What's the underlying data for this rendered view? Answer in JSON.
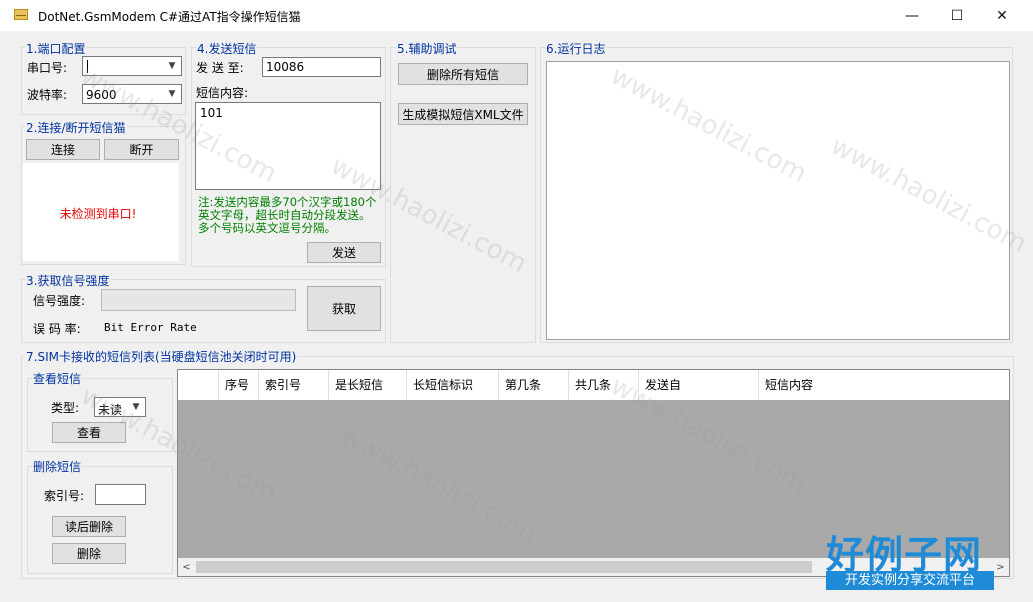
{
  "window": {
    "title": "DotNet.GsmModem C#通过AT指令操作短信猫",
    "controls": {
      "minimize": "—",
      "maximize": "☐",
      "close": "✕"
    }
  },
  "port_config": {
    "title": "1.端口配置",
    "port_label": "串口号:",
    "port_value": "",
    "baud_label": "波特率:",
    "baud_value": "9600"
  },
  "connection": {
    "title": "2.连接/断开短信猫",
    "connect_label": "连接",
    "disconnect_label": "断开",
    "status_text": "未检测到串口!",
    "status_color": "#e00000"
  },
  "send_sms": {
    "title": "4.发送短信",
    "to_label": "发 送 至:",
    "to_value": "10086",
    "content_label": "短信内容:",
    "content_value": "101",
    "note": "注:发送内容最多70个汉字或180个英文字母，超长时自动分段发送。多个号码以英文逗号分隔。",
    "note_color": "#008000",
    "send_label": "发送"
  },
  "debug": {
    "title": "5.辅助调试",
    "delete_all_label": "删除所有短信",
    "gen_xml_label": "生成模拟短信XML文件"
  },
  "log": {
    "title": "6.运行日志"
  },
  "signal": {
    "title": "3.获取信号强度",
    "strength_label": "信号强度:",
    "error_rate_label": "误 码 率:",
    "error_rate_value": "Bit Error Rate",
    "get_label": "获取"
  },
  "sim_list": {
    "title": "7.SIM卡接收的短信列表(当硬盘短信池关闭时可用)",
    "view": {
      "title": "查看短信",
      "type_label": "类型:",
      "type_value": "未读",
      "view_label": "查看"
    },
    "delete": {
      "title": "删除短信",
      "index_label": "索引号:",
      "index_value": "",
      "read_delete_label": "读后删除",
      "delete_label": "删除"
    },
    "columns": [
      "序号",
      "索引号",
      "是长短信",
      "长短信标识",
      "第几条",
      "共几条",
      "发送自",
      "短信内容"
    ]
  },
  "watermark": {
    "text": "www.haolizi.com",
    "logo_main": "好例子网",
    "logo_sub": "开发实例分享交流平台"
  }
}
